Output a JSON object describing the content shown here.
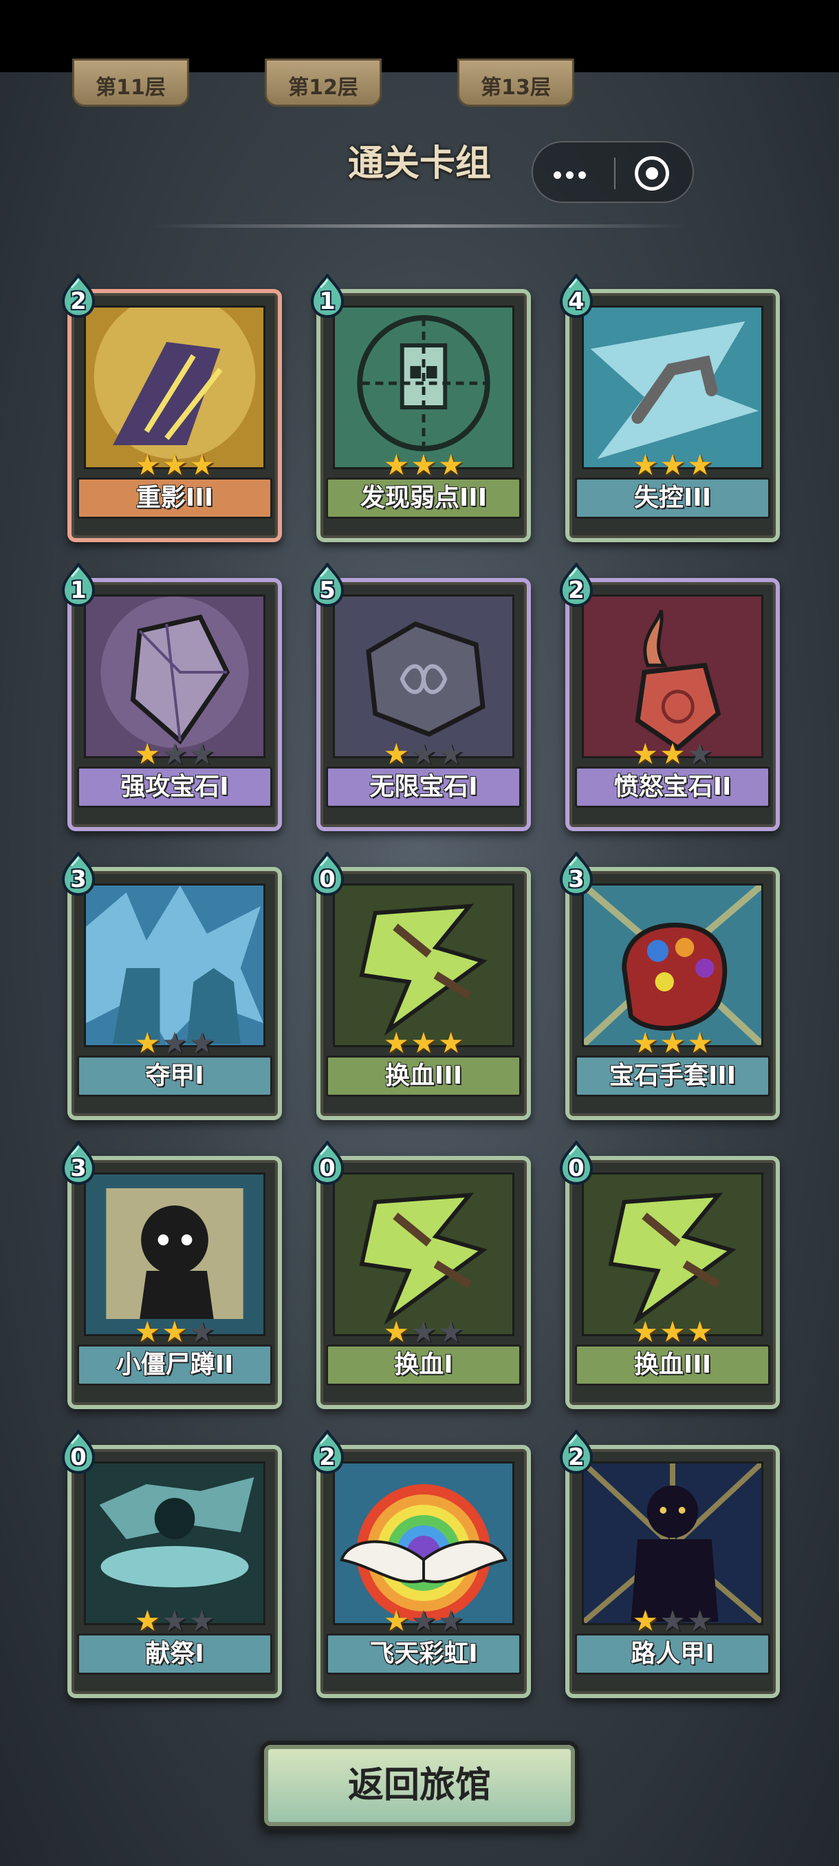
{
  "floor_tabs": [
    "第11层",
    "第12层",
    "第13层"
  ],
  "title": "通关卡组",
  "return_button": "返回旅馆",
  "colors": {
    "star_on": "#f7c02b",
    "star_off": "#4a4d55"
  },
  "cards": [
    {
      "cost": "2",
      "name": "重影III",
      "stars": 3,
      "rarity": "red",
      "plate": "#d58a55",
      "art": "#b58b2e",
      "icon": "shadow-claw-icon"
    },
    {
      "cost": "1",
      "name": "发现弱点III",
      "stars": 3,
      "rarity": "normal",
      "plate": "#7f9c5a",
      "art": "#3e7a63",
      "icon": "target-robot-icon"
    },
    {
      "cost": "4",
      "name": "失控III",
      "stars": 3,
      "rarity": "normal",
      "plate": "#5f9aa5",
      "art": "#3e8fa0",
      "icon": "lightning-arm-icon"
    },
    {
      "cost": "1",
      "name": "强攻宝石I",
      "stars": 1,
      "rarity": "purple",
      "plate": "#9a86c9",
      "art": "#5e4a6f",
      "icon": "crystal-gem-icon"
    },
    {
      "cost": "5",
      "name": "无限宝石I",
      "stars": 1,
      "rarity": "purple",
      "plate": "#9a86c9",
      "art": "#4a4a62",
      "icon": "infinity-gem-icon"
    },
    {
      "cost": "2",
      "name": "愤怒宝石II",
      "stars": 2,
      "rarity": "purple",
      "plate": "#9a86c9",
      "art": "#6a2b3a",
      "icon": "rage-gem-icon"
    },
    {
      "cost": "3",
      "name": "夺甲I",
      "stars": 1,
      "rarity": "normal",
      "plate": "#5f9aa5",
      "art": "#3a7ea6",
      "icon": "armor-steal-icon"
    },
    {
      "cost": "0",
      "name": "换血III",
      "stars": 3,
      "rarity": "normal",
      "plate": "#7f9c5a",
      "art": "#3a4a2a",
      "icon": "blood-swap-icon"
    },
    {
      "cost": "3",
      "name": "宝石手套III",
      "stars": 3,
      "rarity": "normal",
      "plate": "#5f9aa5",
      "art": "#3b7e8f",
      "icon": "gem-gauntlet-icon"
    },
    {
      "cost": "3",
      "name": "小僵尸蹲II",
      "stars": 2,
      "rarity": "normal",
      "plate": "#5f9aa5",
      "art": "#2a5a6a",
      "icon": "zombie-squat-icon"
    },
    {
      "cost": "0",
      "name": "换血I",
      "stars": 1,
      "rarity": "normal",
      "plate": "#7f9c5a",
      "art": "#3a4a2a",
      "icon": "blood-swap-icon"
    },
    {
      "cost": "0",
      "name": "换血III",
      "stars": 3,
      "rarity": "normal",
      "plate": "#7f9c5a",
      "art": "#3a4a2a",
      "icon": "blood-swap-icon"
    },
    {
      "cost": "0",
      "name": "献祭I",
      "stars": 1,
      "rarity": "normal",
      "plate": "#5f9aa5",
      "art": "#1e3a3a",
      "icon": "sacrifice-icon"
    },
    {
      "cost": "2",
      "name": "飞天彩虹I",
      "stars": 1,
      "rarity": "normal",
      "plate": "#5f9aa5",
      "art": "#2f6d8a",
      "icon": "rainbow-wings-icon"
    },
    {
      "cost": "2",
      "name": "路人甲I",
      "stars": 1,
      "rarity": "normal",
      "plate": "#5f9aa5",
      "art": "#1b2a4a",
      "icon": "passerby-icon"
    }
  ]
}
